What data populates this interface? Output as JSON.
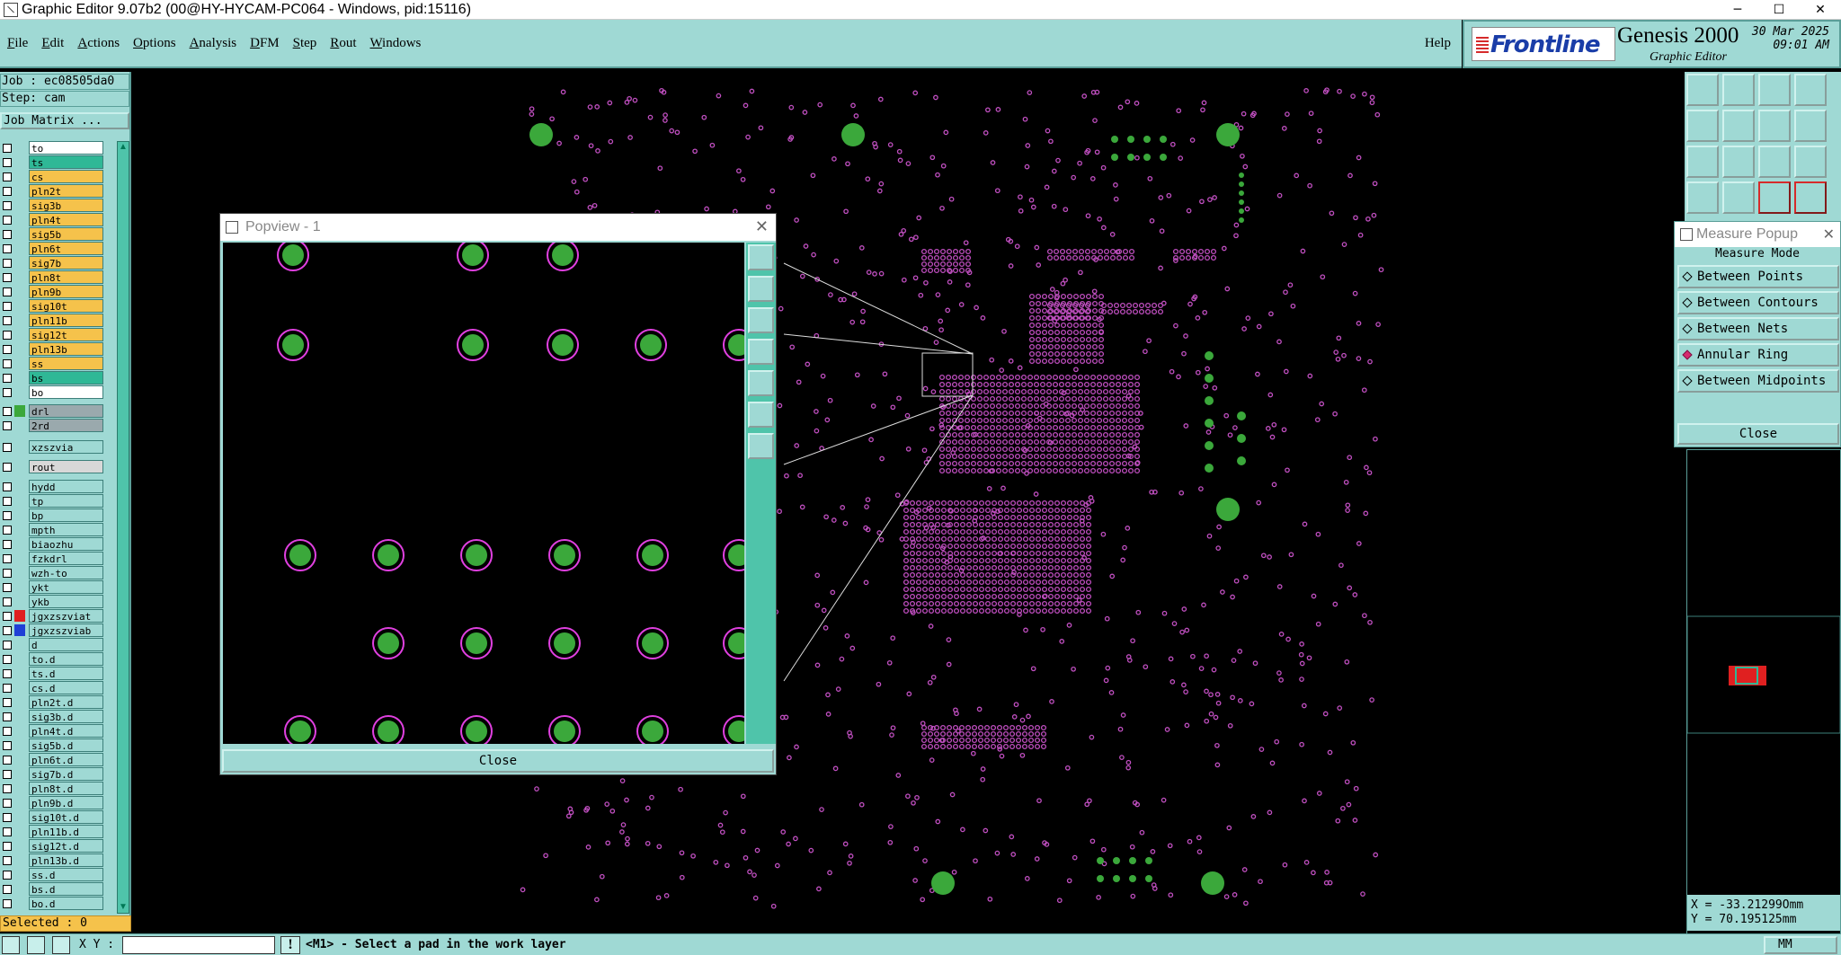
{
  "window": {
    "title": "Graphic Editor 9.07b2 (00@HY-HYCAM-PC064 - Windows, pid:15116)",
    "minimize": "─",
    "maximize": "☐",
    "close": "✕"
  },
  "menu": {
    "items": [
      "File",
      "Edit",
      "Actions",
      "Options",
      "Analysis",
      "DFM",
      "Step",
      "Rout",
      "Windows"
    ],
    "help": "Help"
  },
  "logo": {
    "brand": "Frontline",
    "product": "Genesis 2000",
    "subtitle": "Graphic Editor",
    "date": "30 Mar 2025",
    "time": "09:01 AM"
  },
  "job": {
    "job_line": "Job : ec08505da0",
    "step_line": "Step: cam",
    "matrix_button": "Job Matrix ..."
  },
  "layers": [
    {
      "name": "to",
      "color": "#ffffff",
      "swatch": ""
    },
    {
      "name": "ts",
      "color": "#2fb896",
      "swatch": ""
    },
    {
      "name": "cs",
      "color": "#f5c24b",
      "swatch": ""
    },
    {
      "name": "pln2t",
      "color": "#f5c24b",
      "swatch": ""
    },
    {
      "name": "sig3b",
      "color": "#f5c24b",
      "swatch": ""
    },
    {
      "name": "pln4t",
      "color": "#f5c24b",
      "swatch": ""
    },
    {
      "name": "sig5b",
      "color": "#f5c24b",
      "swatch": ""
    },
    {
      "name": "pln6t",
      "color": "#f5c24b",
      "swatch": ""
    },
    {
      "name": "sig7b",
      "color": "#f5c24b",
      "swatch": ""
    },
    {
      "name": "pln8t",
      "color": "#f5c24b",
      "swatch": ""
    },
    {
      "name": "pln9b",
      "color": "#f5c24b",
      "swatch": ""
    },
    {
      "name": "sig10t",
      "color": "#f5c24b",
      "swatch": ""
    },
    {
      "name": "pln11b",
      "color": "#f5c24b",
      "swatch": ""
    },
    {
      "name": "sig12t",
      "color": "#f5c24b",
      "swatch": ""
    },
    {
      "name": "pln13b",
      "color": "#f5c24b",
      "swatch": ""
    },
    {
      "name": "ss",
      "color": "#f5c24b",
      "swatch": ""
    },
    {
      "name": "bs",
      "color": "#2fb896",
      "swatch": ""
    },
    {
      "name": "bo",
      "color": "#ffffff",
      "swatch": ""
    },
    {
      "name": "drl",
      "color": "#9aa9ad",
      "swatch": "#3ba83b"
    },
    {
      "name": "2rd",
      "color": "#9aa9ad",
      "swatch": ""
    },
    {
      "name": "xzszvia",
      "color": "#9fd9d4",
      "swatch": ""
    },
    {
      "name": "rout",
      "color": "#d8d8d8",
      "swatch": ""
    },
    {
      "name": "hydd",
      "color": "#9fd9d4",
      "swatch": ""
    },
    {
      "name": "tp",
      "color": "#9fd9d4",
      "swatch": ""
    },
    {
      "name": "bp",
      "color": "#9fd9d4",
      "swatch": ""
    },
    {
      "name": "mpth",
      "color": "#9fd9d4",
      "swatch": ""
    },
    {
      "name": "biaozhu",
      "color": "#9fd9d4",
      "swatch": ""
    },
    {
      "name": "fzkdrl",
      "color": "#9fd9d4",
      "swatch": ""
    },
    {
      "name": "wzh-to",
      "color": "#9fd9d4",
      "swatch": ""
    },
    {
      "name": "ykt",
      "color": "#9fd9d4",
      "swatch": ""
    },
    {
      "name": "ykb",
      "color": "#9fd9d4",
      "swatch": ""
    },
    {
      "name": "jgxzszviat",
      "color": "#9fd9d4",
      "swatch": "#e02020"
    },
    {
      "name": "jgxzszviab",
      "color": "#9fd9d4",
      "swatch": "#1f3fd6"
    },
    {
      "name": "d",
      "color": "#9fd9d4",
      "swatch": ""
    },
    {
      "name": "to.d",
      "color": "#9fd9d4",
      "swatch": ""
    },
    {
      "name": "ts.d",
      "color": "#9fd9d4",
      "swatch": ""
    },
    {
      "name": "cs.d",
      "color": "#9fd9d4",
      "swatch": ""
    },
    {
      "name": "pln2t.d",
      "color": "#9fd9d4",
      "swatch": ""
    },
    {
      "name": "sig3b.d",
      "color": "#9fd9d4",
      "swatch": ""
    },
    {
      "name": "pln4t.d",
      "color": "#9fd9d4",
      "swatch": ""
    },
    {
      "name": "sig5b.d",
      "color": "#9fd9d4",
      "swatch": ""
    },
    {
      "name": "pln6t.d",
      "color": "#9fd9d4",
      "swatch": ""
    },
    {
      "name": "sig7b.d",
      "color": "#9fd9d4",
      "swatch": ""
    },
    {
      "name": "pln8t.d",
      "color": "#9fd9d4",
      "swatch": ""
    },
    {
      "name": "pln9b.d",
      "color": "#9fd9d4",
      "swatch": ""
    },
    {
      "name": "sig10t.d",
      "color": "#9fd9d4",
      "swatch": ""
    },
    {
      "name": "pln11b.d",
      "color": "#9fd9d4",
      "swatch": ""
    },
    {
      "name": "sig12t.d",
      "color": "#9fd9d4",
      "swatch": ""
    },
    {
      "name": "pln13b.d",
      "color": "#9fd9d4",
      "swatch": ""
    },
    {
      "name": "ss.d",
      "color": "#9fd9d4",
      "swatch": ""
    },
    {
      "name": "bs.d",
      "color": "#9fd9d4",
      "swatch": ""
    },
    {
      "name": "bo.d",
      "color": "#9fd9d4",
      "swatch": ""
    }
  ],
  "selected": "Selected : 0",
  "popview": {
    "title": "Popview - 1",
    "close_glyph": "✕",
    "close_button": "Close"
  },
  "measure": {
    "title": "Measure Popup",
    "close_glyph": "✕",
    "mode_header": "Measure Mode",
    "options": [
      {
        "label": "Between Points",
        "selected": false
      },
      {
        "label": "Between Contours",
        "selected": false
      },
      {
        "label": "Between Nets",
        "selected": false
      },
      {
        "label": "Annular Ring",
        "selected": true
      },
      {
        "label": "Between Midpoints",
        "selected": false
      }
    ],
    "close_button": "Close"
  },
  "coords": {
    "x": "X = -33.21299Omm",
    "y": "Y = 70.195125mm"
  },
  "status": {
    "xy_label": "X Y :",
    "xy_value": "",
    "message": "<M1> - Select a pad in the work layer",
    "units": "MM"
  },
  "colors": {
    "panel": "#9fd9d4",
    "pad_green": "#3ba83b",
    "via_magenta": "#c04fc0",
    "popview_ring": "#e040e0"
  }
}
